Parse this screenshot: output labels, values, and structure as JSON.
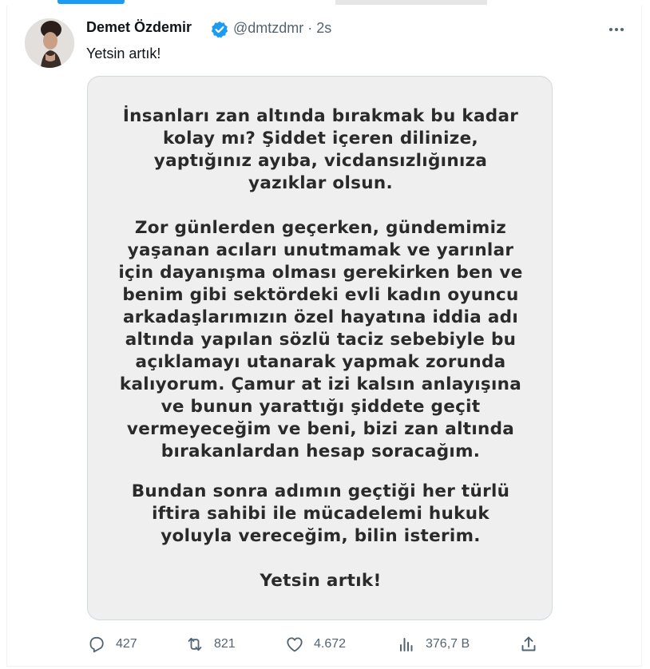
{
  "user": {
    "name": "Demet Özdemir",
    "handle": "@dmtzdmr",
    "time": "· 2s"
  },
  "tweet": {
    "text": "Yetsin artık!"
  },
  "image_text": {
    "p1": [
      "İnsanları zan altında bırakmak bu kadar",
      "kolay mı? Şiddet içeren dilinize,",
      "yaptığınız ayıba, vicdansızlığınıza",
      "yazıklar olsun."
    ],
    "p2": [
      "Zor günlerden geçerken, gündemimiz",
      "yaşanan acıları unutmamak ve yarınlar",
      "için dayanışma olması gerekirken ben ve",
      "benim gibi sektördeki evli kadın oyuncu",
      "arkadaşlarımızın özel hayatına iddia adı",
      "altında yapılan sözlü taciz sebebiyle bu",
      "açıklamayı utanarak yapmak zorunda",
      "kalıyorum. Çamur at izi kalsın anlayışına",
      "ve bunun yarattığı şiddete geçit",
      "vermeyeceğim ve beni, bizi zan altında",
      "bırakanlardan hesap soracağım."
    ],
    "p3": [
      "Bundan sonra adımın geçtiği her türlü",
      "iftira sahibi ile mücadelemi hukuk",
      "yoluyla vereceğim, bilin isterim."
    ],
    "p4": [
      "Yetsin artık!"
    ]
  },
  "actions": {
    "replies": "427",
    "reposts": "821",
    "likes": "4.672",
    "views": "376,7 B"
  },
  "icons": [
    "verified-badge-icon",
    "more-icon",
    "reply-icon",
    "repost-icon",
    "like-icon",
    "views-icon",
    "share-icon"
  ],
  "colors": {
    "accent": "#1d9bf0",
    "muted": "#536471",
    "text": "#0f1419"
  }
}
